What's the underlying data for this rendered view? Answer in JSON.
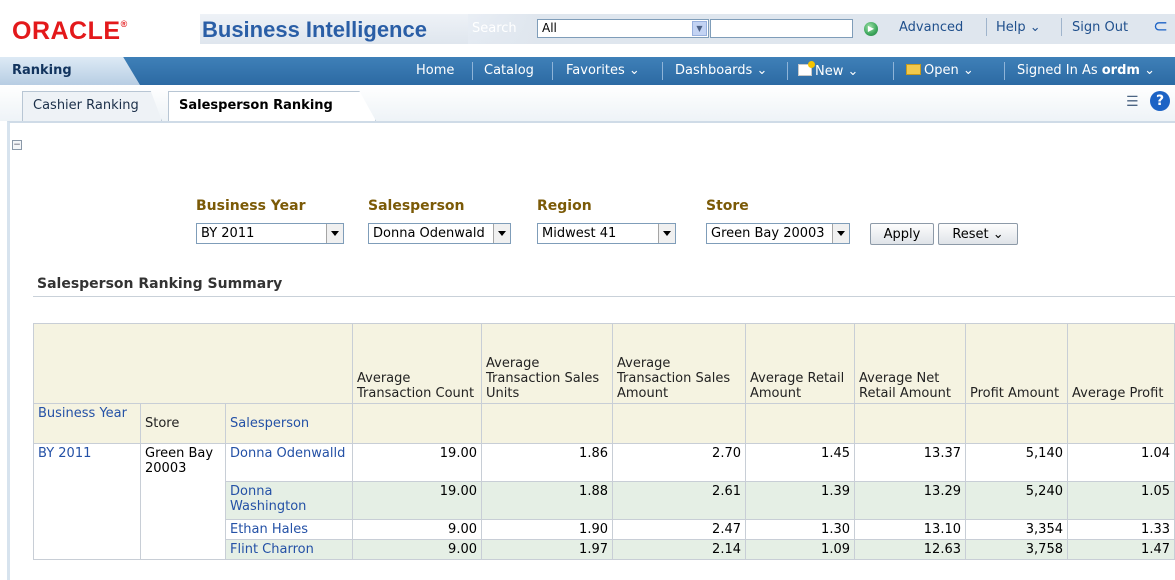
{
  "brand": {
    "logo": "ORACLE",
    "product": "Business Intelligence"
  },
  "search": {
    "label": "Search",
    "scope": "All",
    "value": ""
  },
  "top_links": {
    "advanced": "Advanced",
    "help": "Help",
    "sign_out": "Sign Out"
  },
  "app_tab": "Ranking",
  "nav": {
    "home": "Home",
    "catalog": "Catalog",
    "favorites": "Favorites",
    "dashboards": "Dashboards",
    "new": "New",
    "open": "Open",
    "signed_in_as": "Signed In As",
    "user": "ordm"
  },
  "page_tabs": [
    "Cashier Ranking",
    "Salesperson Ranking"
  ],
  "prompts": {
    "business_year": {
      "label": "Business Year",
      "value": "BY 2011"
    },
    "salesperson": {
      "label": "Salesperson",
      "value": "Donna Odenwald"
    },
    "region": {
      "label": "Region",
      "value": "Midwest 41"
    },
    "store": {
      "label": "Store",
      "value": "Green Bay 20003"
    },
    "apply": "Apply",
    "reset": "Reset"
  },
  "section_title": "Salesperson Ranking Summary",
  "table": {
    "measure_headers": [
      "Average Transaction Count",
      "Average Transaction Sales Units",
      "Average Transaction Sales Amount",
      "Average Retail Amount",
      "Average Net Retail Amount",
      "Profit Amount",
      "Average Profit"
    ],
    "dim_headers": [
      "Business Year",
      "Store",
      "Salesperson"
    ],
    "business_year": "BY 2011",
    "store": "Green Bay 20003",
    "rows": [
      {
        "salesperson": "Donna Odenwalld",
        "values": [
          "19.00",
          "1.86",
          "2.70",
          "1.45",
          "13.37",
          "5,140",
          "1.04"
        ]
      },
      {
        "salesperson": "Donna Washington",
        "values": [
          "19.00",
          "1.88",
          "2.61",
          "1.39",
          "13.29",
          "5,240",
          "1.05"
        ]
      },
      {
        "salesperson": "Ethan Hales",
        "values": [
          "9.00",
          "1.90",
          "2.47",
          "1.30",
          "13.10",
          "3,354",
          "1.33"
        ]
      },
      {
        "salesperson": "Flint Charron",
        "values": [
          "9.00",
          "1.97",
          "2.14",
          "1.09",
          "12.63",
          "3,758",
          "1.47"
        ]
      }
    ]
  },
  "colors": {
    "brand_red": "#e3191b",
    "title_blue": "#2a5ea6",
    "nav_blue": "#2c6aa3",
    "prompt_label": "#7b5a07",
    "header_bg": "#f5f3e1",
    "alt_row": "#e5efe5"
  }
}
